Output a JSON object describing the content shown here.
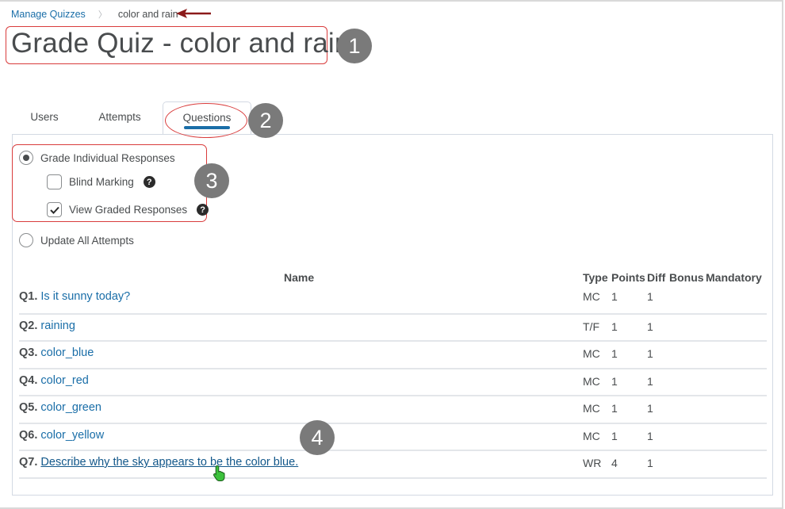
{
  "breadcrumb": {
    "parent": "Manage Quizzes",
    "current": "color and rain"
  },
  "page": {
    "title": "Grade Quiz - color and rain"
  },
  "tabs": [
    {
      "label": "Users",
      "active": false
    },
    {
      "label": "Attempts",
      "active": false
    },
    {
      "label": "Questions",
      "active": true
    }
  ],
  "options": {
    "grade_individual": {
      "label": "Grade Individual Responses",
      "selected": true
    },
    "blind_marking": {
      "label": "Blind Marking",
      "checked": false,
      "help_icon": "question-circle-icon"
    },
    "view_graded": {
      "label": "View Graded Responses",
      "checked": true,
      "help_icon": "question-circle-icon"
    },
    "update_all": {
      "label": "Update All Attempts",
      "selected": false
    }
  },
  "table": {
    "columns": [
      "Name",
      "Type",
      "Points",
      "Diff",
      "Bonus",
      "Mandatory"
    ],
    "rows": [
      {
        "num": "Q1.",
        "name": "Is it sunny today?",
        "type": "MC",
        "points": "1",
        "diff": "1",
        "bonus": "",
        "mandatory": ""
      },
      {
        "num": "Q2.",
        "name": "raining",
        "type": "T/F",
        "points": "1",
        "diff": "1",
        "bonus": "",
        "mandatory": ""
      },
      {
        "num": "Q3.",
        "name": "color_blue",
        "type": "MC",
        "points": "1",
        "diff": "1",
        "bonus": "",
        "mandatory": ""
      },
      {
        "num": "Q4.",
        "name": "color_red",
        "type": "MC",
        "points": "1",
        "diff": "1",
        "bonus": "",
        "mandatory": ""
      },
      {
        "num": "Q5.",
        "name": "color_green",
        "type": "MC",
        "points": "1",
        "diff": "1",
        "bonus": "",
        "mandatory": ""
      },
      {
        "num": "Q6.",
        "name": "color_yellow",
        "type": "MC",
        "points": "1",
        "diff": "1",
        "bonus": "",
        "mandatory": ""
      },
      {
        "num": "Q7.",
        "name": "Describe why the sky appears to be the color blue.",
        "type": "WR",
        "points": "4",
        "diff": "1",
        "bonus": "",
        "mandatory": ""
      }
    ]
  },
  "annotations": {
    "badges": [
      "1",
      "2",
      "3",
      "4"
    ],
    "colors": {
      "highlight": "#d93c3c",
      "arrow": "#8b1a1a",
      "badge": "#7a7a7a",
      "link": "#1a6ea8",
      "cursor": "#3cc13c"
    }
  }
}
